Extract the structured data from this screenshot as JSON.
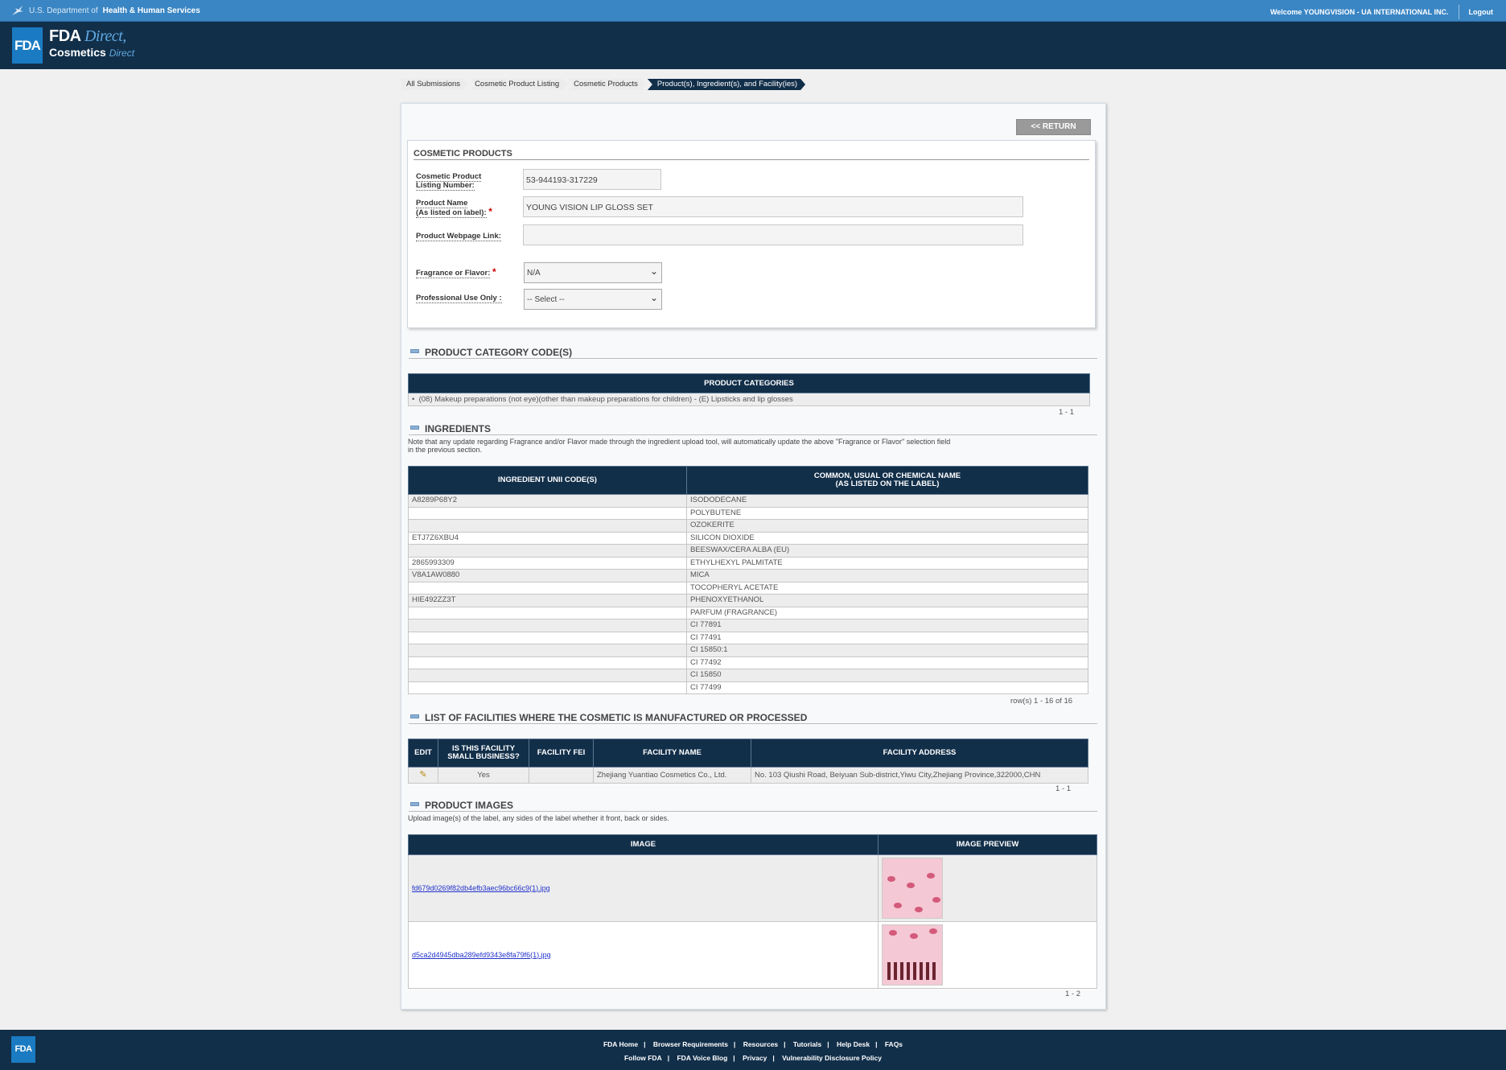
{
  "hhs": {
    "prefix": "U.S. Department of",
    "agency": "Health & Human Services",
    "welcome": "Welcome YOUNGVISION - UA INTERNATIONAL INC.",
    "logout": "Logout"
  },
  "brand": {
    "logo": "FDA",
    "fda": "FDA",
    "direct": "Direct,",
    "cosmetics": "Cosmetics",
    "direct2": "Direct"
  },
  "breadcrumb": [
    "All Submissions",
    "Cosmetic Product Listing",
    "Cosmetic Products",
    "Product(s), Ingredient(s), and Facility(ies)"
  ],
  "return_label": "<< RETURN",
  "cosmetic_products": {
    "title": "COSMETIC PRODUCTS",
    "listing_label_1": "Cosmetic Product",
    "listing_label_2": "Listing Number:",
    "listing_value": "53-944193-317229",
    "name_label_1": "Product Name",
    "name_label_2": "(As listed on label):",
    "name_value": "YOUNG VISION LIP GLOSS SET",
    "webpage_label": "Product Webpage Link:",
    "webpage_value": "",
    "fragrance_label": "Fragrance or Flavor:",
    "fragrance_value": "N/A",
    "professional_label": "Professional Use Only :",
    "professional_value": "-- Select --"
  },
  "categories": {
    "title": "PRODUCT CATEGORY CODE(S)",
    "header": "PRODUCT CATEGORIES",
    "items": [
      "(08) Makeup preparations (not eye)(other than makeup preparations for children) - (E) Lipsticks and lip glosses"
    ],
    "pager": "1 - 1"
  },
  "ingredients": {
    "title": "INGREDIENTS",
    "note_1": "Note that any update regarding Fragrance and/or Flavor made through the ingredient upload tool, will automatically update the above \"Fragrance or Flavor\" selection field",
    "note_2": "in the previous section.",
    "col_code": "INGREDIENT UNII CODE(S)",
    "col_name_1": "COMMON, USUAL OR CHEMICAL NAME",
    "col_name_2": "(AS LISTED ON THE LABEL)",
    "rows": [
      {
        "code": "A8289P68Y2",
        "name": "ISODODECANE"
      },
      {
        "code": "",
        "name": "POLYBUTENE"
      },
      {
        "code": "",
        "name": "OZOKERITE"
      },
      {
        "code": "ETJ7Z6XBU4",
        "name": "SILICON DIOXIDE"
      },
      {
        "code": "",
        "name": "BEESWAX/CERA ALBA (EU)"
      },
      {
        "code": "2865993309",
        "name": "ETHYLHEXYL PALMITATE"
      },
      {
        "code": "V8A1AW0880",
        "name": "MICA"
      },
      {
        "code": "",
        "name": "TOCOPHERYL ACETATE"
      },
      {
        "code": "HIE492ZZ3T",
        "name": "PHENOXYETHANOL"
      },
      {
        "code": "",
        "name": "PARFUM (FRAGRANCE)"
      },
      {
        "code": "",
        "name": "CI 77891"
      },
      {
        "code": "",
        "name": "CI 77491"
      },
      {
        "code": "",
        "name": "CI 15850:1"
      },
      {
        "code": "",
        "name": "CI 77492"
      },
      {
        "code": "",
        "name": "CI 15850"
      },
      {
        "code": "",
        "name": "CI 77499"
      }
    ],
    "pager": "row(s) 1 - 16 of 16"
  },
  "facilities": {
    "title": "LIST OF FACILITIES WHERE THE COSMETIC IS MANUFACTURED OR PROCESSED",
    "col_edit": "EDIT",
    "col_small_1": "IS THIS FACILITY",
    "col_small_2": "SMALL BUSINESS?",
    "col_fei": "FACILITY FEI",
    "col_name": "FACILITY NAME",
    "col_address": "FACILITY ADDRESS",
    "rows": [
      {
        "small": "Yes",
        "fei": "",
        "name": "Zhejiang Yuantiao Cosmetics Co., Ltd.",
        "address": "No. 103 Qiushi Road, Beiyuan Sub-district,Yiwu City,Zhejiang Province,322000,CHN"
      }
    ],
    "pager": "1 - 1"
  },
  "images": {
    "title": "PRODUCT IMAGES",
    "note": "Upload image(s) of the label, any sides of the label whether it front, back or sides.",
    "col_image": "IMAGE",
    "col_preview": "IMAGE PREVIEW",
    "rows": [
      {
        "file": "fd679d0269f82db4efb3aec96bc66c9(1).jpg"
      },
      {
        "file": "d5ca2d4945dba289efd9343e8fa79f6(1).jpg"
      }
    ],
    "pager": "1 - 2"
  },
  "footer": {
    "logo": "FDA",
    "row1": [
      "FDA Home",
      "Browser Requirements",
      "Resources",
      "Tutorials",
      "Help Desk",
      "FAQs"
    ],
    "row2": [
      "Follow FDA",
      "FDA Voice Blog",
      "Privacy",
      "Vulnerability Disclosure Policy"
    ]
  },
  "colors": {
    "navy": "#122f4a",
    "hhs_blue": "#3a86c4",
    "fda_blue": "#1a7bc2"
  }
}
